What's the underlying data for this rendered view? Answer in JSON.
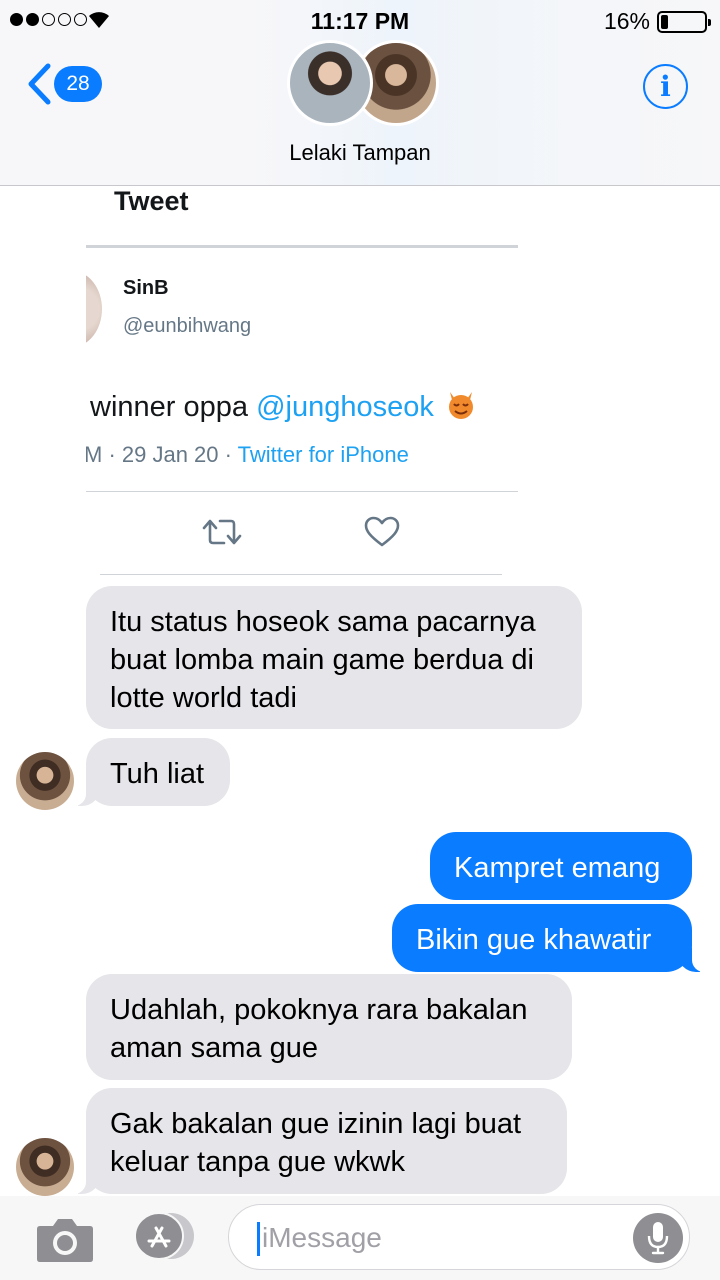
{
  "status_bar": {
    "time": "11:17 PM",
    "battery": "16%",
    "signal_bars_filled": 2,
    "signal_bars_total": 5
  },
  "header": {
    "unread_count": "28",
    "contact_name": "Lelaki Tampan",
    "info_label": "i"
  },
  "tweet": {
    "heading": "Tweet",
    "author": "SinB",
    "handle": "@eunbihwang",
    "text": "winner oppa ",
    "mention": "@junghoseok",
    "emoji": "devil-emoji",
    "meta": "M · 29 Jan 20 · ",
    "source": "Twitter for iPhone"
  },
  "messages": [
    {
      "from": "them",
      "text": "Itu status hoseok sama pacarnya buat lomba main game berdua di lotte world tadi"
    },
    {
      "from": "them",
      "text": "Tuh liat"
    },
    {
      "from": "me",
      "text": "Kampret emang"
    },
    {
      "from": "me",
      "text": "Bikin gue khawatir"
    },
    {
      "from": "them",
      "text": "Udahlah, pokoknya rara bakalan aman sama gue"
    },
    {
      "from": "them",
      "text": "Gak bakalan gue izinin lagi buat keluar tanpa gue wkwk"
    }
  ],
  "input": {
    "placeholder": "iMessage"
  },
  "colors": {
    "accent": "#0a7cff",
    "incoming_bubble": "#e5e5ea",
    "twitter_blue": "#1da1f2"
  }
}
